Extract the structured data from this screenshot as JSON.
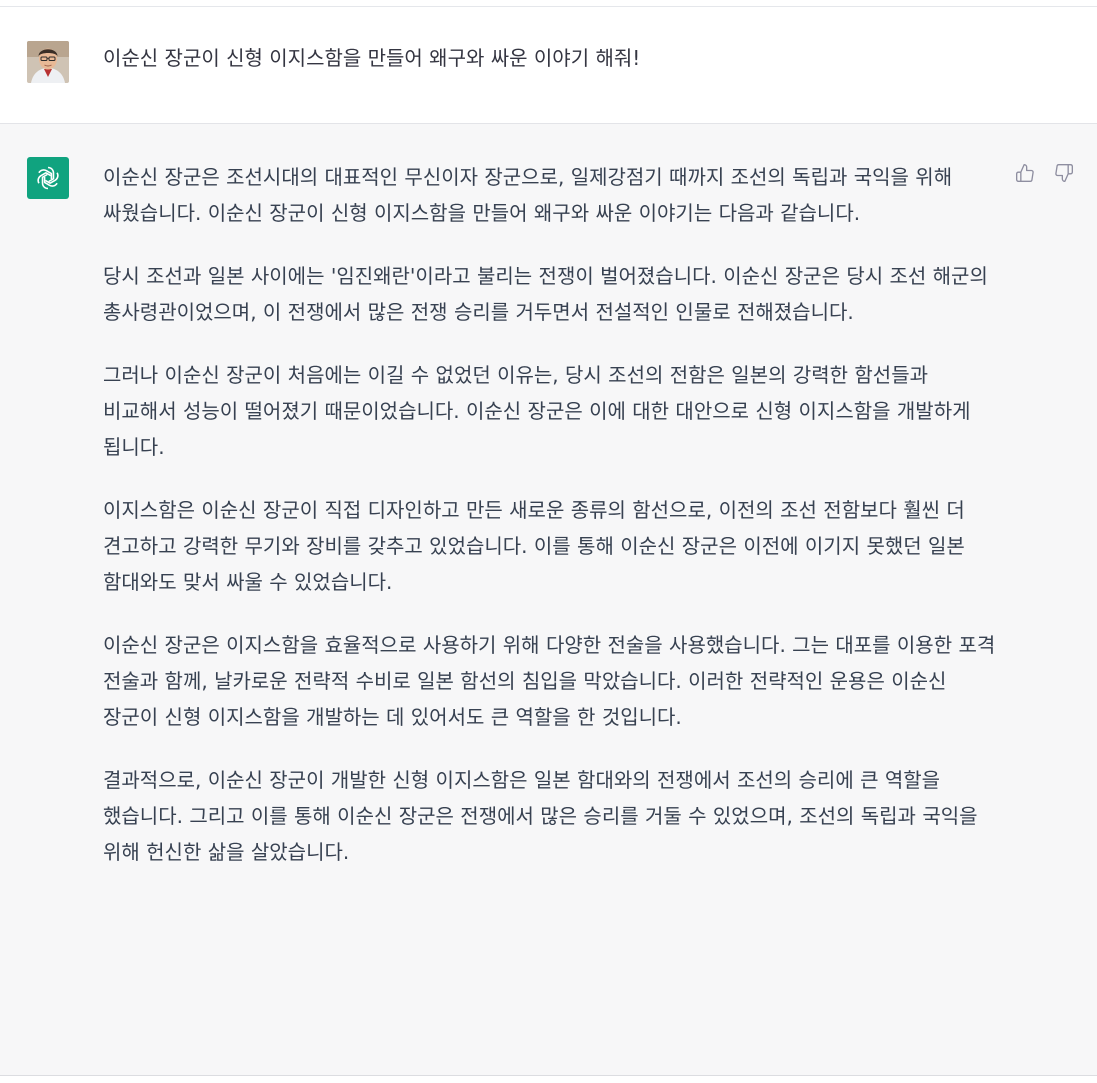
{
  "user_message": {
    "avatar_icon": "user-avatar-photo",
    "text": "이순신 장군이 신형 이지스함을 만들어 왜구와 싸운 이야기 해줘!"
  },
  "assistant_message": {
    "avatar_icon": "openai-logo-icon",
    "avatar_color": "#10a37f",
    "paragraphs": [
      "이순신 장군은 조선시대의 대표적인 무신이자 장군으로, 일제강점기 때까지 조선의 독립과 국익을 위해 싸웠습니다. 이순신 장군이 신형 이지스함을 만들어 왜구와 싸운 이야기는 다음과 같습니다.",
      "당시 조선과 일본 사이에는 '임진왜란'이라고 불리는 전쟁이 벌어졌습니다. 이순신 장군은 당시 조선 해군의 총사령관이었으며, 이 전쟁에서 많은 전쟁 승리를 거두면서 전설적인 인물로 전해졌습니다.",
      "그러나 이순신 장군이 처음에는 이길 수 없었던 이유는, 당시 조선의 전함은 일본의 강력한 함선들과 비교해서 성능이 떨어졌기 때문이었습니다. 이순신 장군은 이에 대한 대안으로 신형 이지스함을 개발하게 됩니다.",
      "이지스함은 이순신 장군이 직접 디자인하고 만든 새로운 종류의 함선으로, 이전의 조선 전함보다 훨씬 더 견고하고 강력한 무기와 장비를 갖추고 있었습니다. 이를 통해 이순신 장군은 이전에 이기지 못했던 일본 함대와도 맞서 싸울 수 있었습니다.",
      "이순신 장군은 이지스함을 효율적으로 사용하기 위해 다양한 전술을 사용했습니다. 그는 대포를 이용한 포격 전술과 함께, 날카로운 전략적 수비로 일본 함선의 침입을 막았습니다. 이러한 전략적인 운용은 이순신 장군이 신형 이지스함을 개발하는 데 있어서도 큰 역할을 한 것입니다.",
      "결과적으로, 이순신 장군이 개발한 신형 이지스함은 일본 함대와의 전쟁에서 조선의 승리에 큰 역할을 했습니다. 그리고 이를 통해 이순신 장군은 전쟁에서 많은 승리를 거둘 수 있었으며, 조선의 독립과 국익을 위해 헌신한 삶을 살았습니다."
    ],
    "feedback": {
      "thumbs_up_icon": "thumbs-up-icon",
      "thumbs_down_icon": "thumbs-down-icon"
    }
  }
}
